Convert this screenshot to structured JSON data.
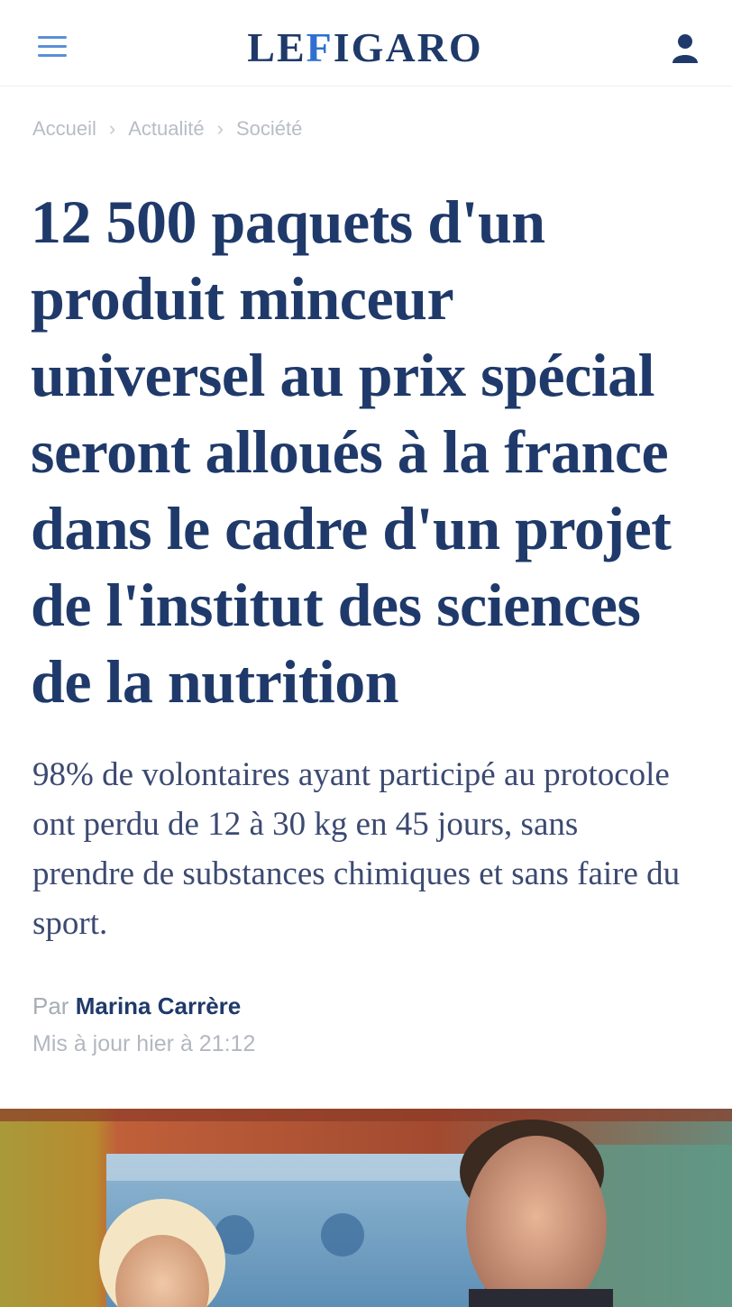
{
  "header": {
    "logo_left": "LE",
    "logo_mid": "F",
    "logo_right": "IGARO",
    "menu_icon": "hamburger-menu-icon",
    "account_icon": "user-account-icon"
  },
  "breadcrumb": [
    "Accueil",
    "Actualité",
    "Société"
  ],
  "article": {
    "title": "12 500 paquets d'un produit minceur universel au prix spécial seront alloués à la france dans le cadre d'un projet de l'institut des sciences de la nutrition",
    "lead": "98% de volontaires ayant participé au protocole ont perdu de 12 à 30 kg en 45 jours, sans prendre de substances chimiques et sans faire du sport.",
    "byline_prefix": "Par",
    "author": "Marina Carrère",
    "date": "Mis à jour hier à 21:12"
  },
  "colors": {
    "brand_navy": "#1f3a6a",
    "brand_blue": "#2f6fd1",
    "muted_text": "#b8bcc6"
  }
}
